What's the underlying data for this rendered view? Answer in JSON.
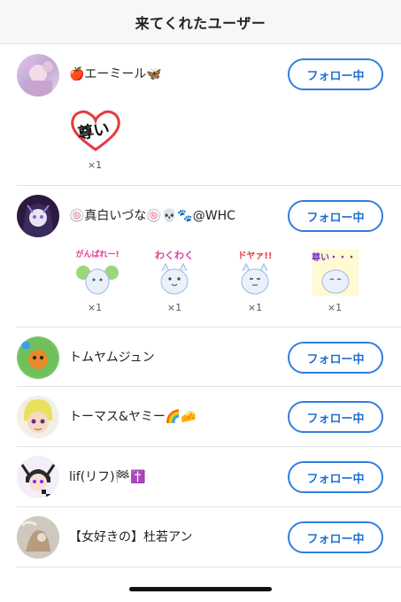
{
  "header": {
    "title": "来てくれたユーザー"
  },
  "follow_label": "フォロー中",
  "users": [
    {
      "name": "🍎エーミール🦋",
      "stamps": [
        {
          "text": "尊い",
          "count": "×1"
        }
      ]
    },
    {
      "name": "🍥真白いづな🍥💀🐾@WHC",
      "stamps": [
        {
          "text": "がんばれー!",
          "count": "×1"
        },
        {
          "text": "わくわく",
          "count": "×1"
        },
        {
          "text": "ドヤァ!!",
          "count": "×1"
        },
        {
          "text": "尊い・・・",
          "count": "×1"
        }
      ]
    },
    {
      "name": "トムヤムジュン",
      "stamps": []
    },
    {
      "name": "トーマス&ヤミー🌈🧀",
      "stamps": []
    },
    {
      "name": "lif(リフ)🏁✝️",
      "stamps": []
    },
    {
      "name": "【女好きの】杜若アン",
      "stamps": []
    }
  ],
  "colors": {
    "accent": "#2f7fe0",
    "header_bg": "#f7f7f7"
  }
}
